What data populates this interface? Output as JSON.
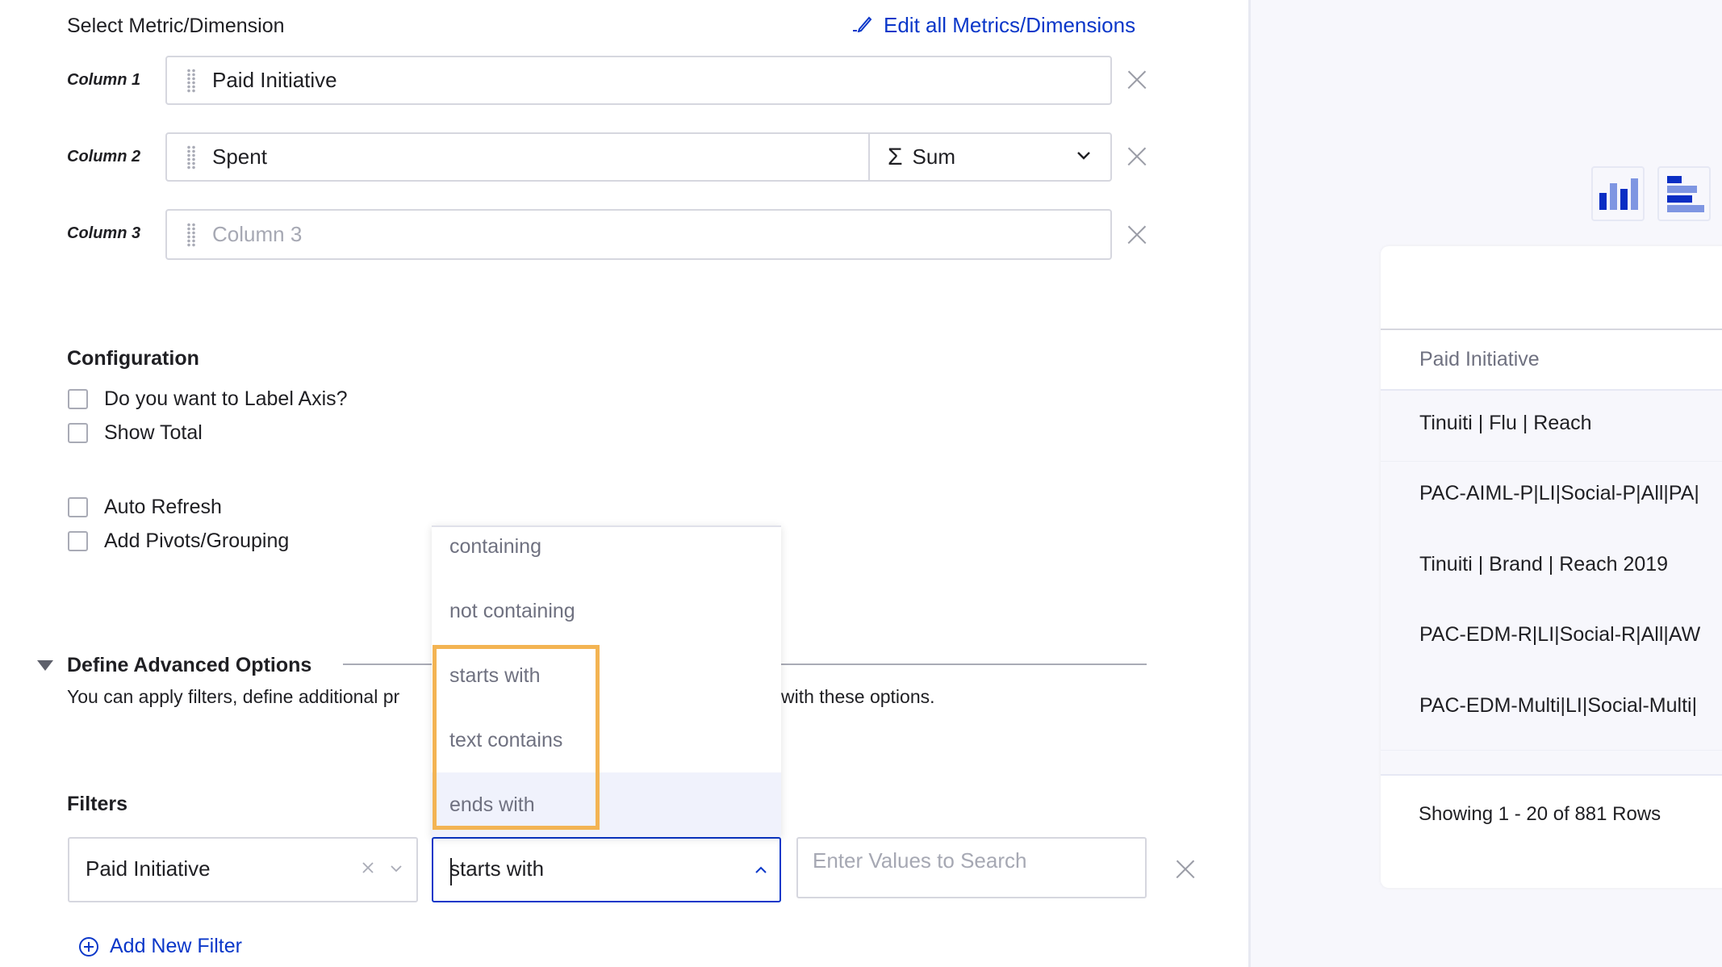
{
  "metrics": {
    "section_label": "Select Metric/Dimension",
    "edit_link": "Edit all Metrics/Dimensions",
    "columns": [
      {
        "label": "Column 1",
        "value": "Paid Initiative",
        "placeholder": ""
      },
      {
        "label": "Column 2",
        "value": "Spent",
        "placeholder": "",
        "aggregation": "Sum"
      },
      {
        "label": "Column 3",
        "value": "",
        "placeholder": "Column 3"
      }
    ]
  },
  "configuration": {
    "title": "Configuration",
    "options": [
      {
        "label": "Do you want to Label Axis?",
        "checked": false
      },
      {
        "label": "Show Total",
        "checked": false
      },
      {
        "label": "Auto Refresh",
        "checked": false
      },
      {
        "label": "Add Pivots/Grouping",
        "checked": false
      }
    ]
  },
  "advanced": {
    "title": "Define Advanced Options",
    "description_left": "You can apply filters, define additional pr",
    "description_right": "with these options."
  },
  "filters": {
    "title": "Filters",
    "field": "Paid Initiative",
    "operator": "starts with",
    "value_placeholder": "Enter Values to Search",
    "add_label": "Add New Filter",
    "dropdown_options": [
      "containing",
      "not containing",
      "starts with",
      "text contains",
      "ends with"
    ],
    "highlighted_options": [
      "starts with",
      "text contains",
      "ends with"
    ],
    "hovered_option": "ends with"
  },
  "preview": {
    "column_header": "Paid Initiative",
    "rows": [
      "Tinuiti | Flu | Reach",
      "PAC-AIML-P|LI|Social-P|All|PA|",
      "Tinuiti | Brand | Reach 2019",
      "PAC-EDM-R|LI|Social-R|All|AW",
      "PAC-EDM-Multi|LI|Social-Multi|"
    ],
    "footer": "Showing 1 - 20 of 881 Rows",
    "chart_types": [
      "column-chart",
      "bar-chart"
    ]
  },
  "colors": {
    "accent": "#0a37c9",
    "highlight_box": "#f3b453",
    "panel_bg": "#f7f7fc"
  }
}
